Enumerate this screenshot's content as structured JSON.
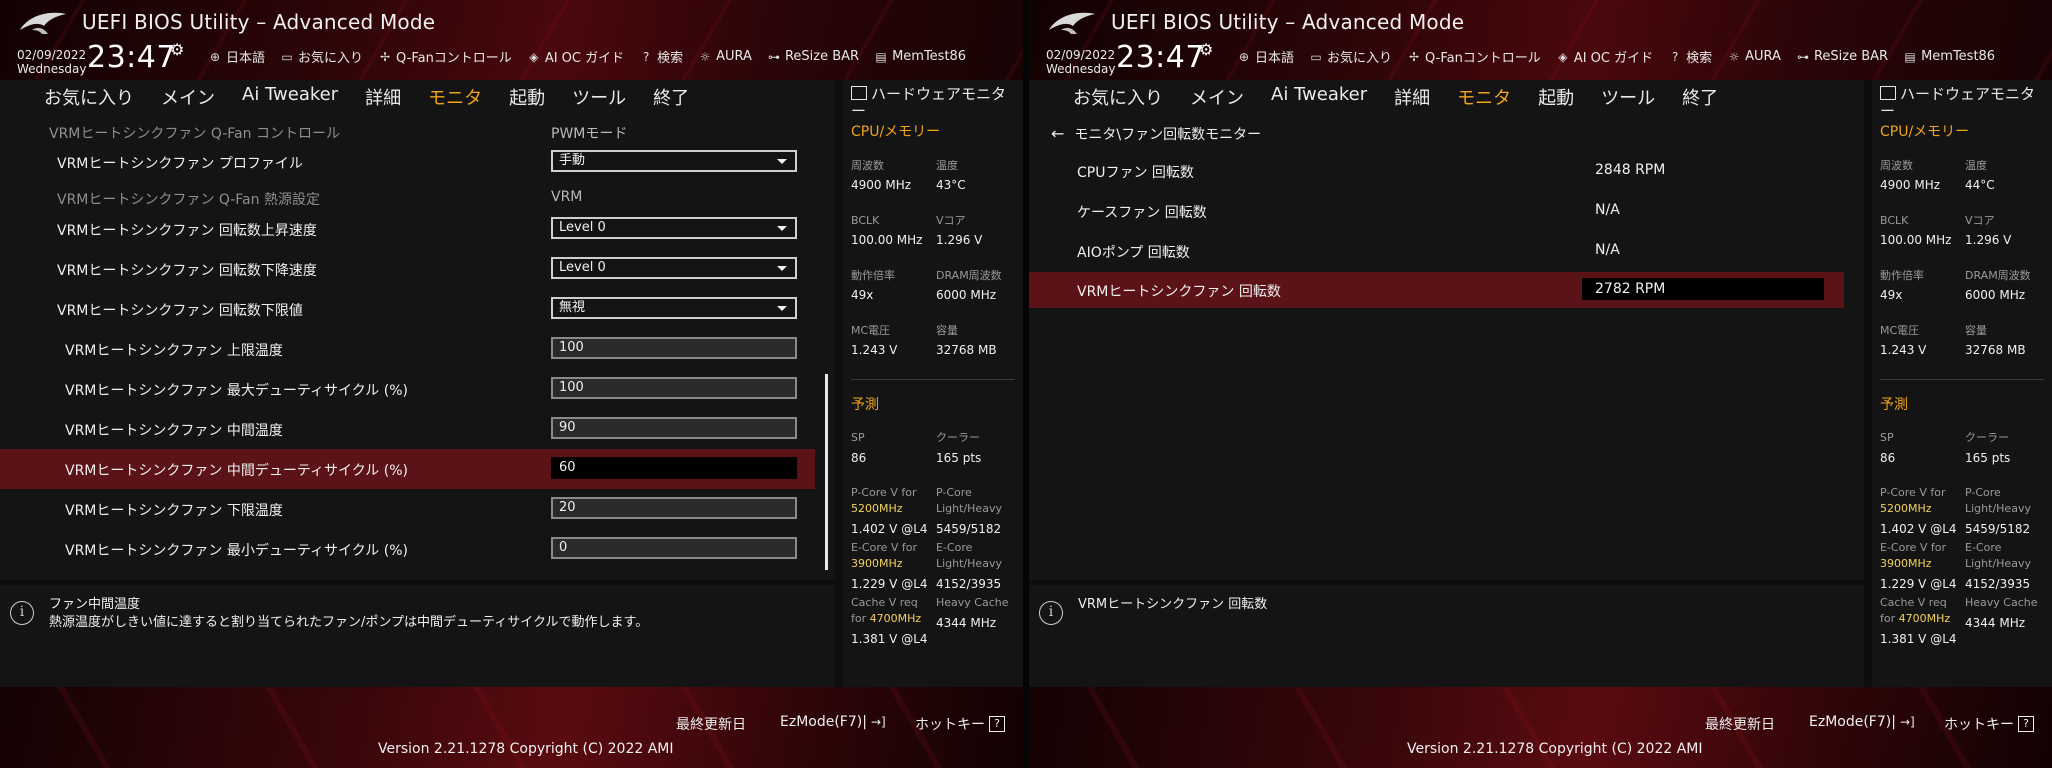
{
  "header": {
    "title": "UEFI BIOS Utility – Advanced Mode",
    "date": "02/09/2022",
    "weekday": "Wednesday",
    "time": "23:47",
    "toolbar": [
      {
        "icon": "globe-icon",
        "label": "日本語"
      },
      {
        "icon": "favorites-icon",
        "label": "お気に入り"
      },
      {
        "icon": "fan-icon",
        "label": "Q-Fanコントロール"
      },
      {
        "icon": "ai-oc-icon",
        "label": "AI OC ガイド"
      },
      {
        "icon": "help-icon",
        "label": "検索"
      },
      {
        "icon": "aura-icon",
        "label": "AURA"
      },
      {
        "icon": "resize-bar-icon",
        "label": "ReSize BAR"
      },
      {
        "icon": "memtest-icon",
        "label": "MemTest86"
      }
    ]
  },
  "menu": [
    "お気に入り",
    "メイン",
    "Ai Tweaker",
    "詳細",
    "モニタ",
    "起動",
    "ツール",
    "終了"
  ],
  "menu_active": "モニタ",
  "left": {
    "rows": [
      {
        "label": "VRMヒートシンクファン Q-Fan コントロール",
        "value": "PWMモード"
      },
      {
        "label": "VRMヒートシンクファン プロファイル",
        "value": "手動"
      },
      {
        "label": "VRMヒートシンクファン Q-Fan 熱源設定",
        "value": "VRM"
      },
      {
        "label": "VRMヒートシンクファン 回転数上昇速度",
        "value": "Level 0"
      },
      {
        "label": "VRMヒートシンクファン 回転数下降速度",
        "value": "Level 0"
      },
      {
        "label": "VRMヒートシンクファン 回転数下限値",
        "value": "無視"
      },
      {
        "label": "VRMヒートシンクファン 上限温度",
        "value": "100"
      },
      {
        "label": "VRMヒートシンクファン 最大デューティサイクル (%)",
        "value": "100"
      },
      {
        "label": "VRMヒートシンクファン 中間温度",
        "value": "90"
      },
      {
        "label": "VRMヒートシンクファン 中間デューティサイクル (%)",
        "value": "60"
      },
      {
        "label": "VRMヒートシンクファン 下限温度",
        "value": "20"
      },
      {
        "label": "VRMヒートシンクファン 最小デューティサイクル (%)",
        "value": "0"
      }
    ],
    "help_title": "ファン中間温度",
    "help_text": "熱源温度がしきい値に達すると割り当てられたファン/ポンプは中間デューティサイクルで動作します。"
  },
  "right": {
    "breadcrumb": "モニタ\\ファン回転数モニター",
    "rows": [
      {
        "label": "CPUファン 回転数",
        "value": "2848 RPM"
      },
      {
        "label": "ケースファン 回転数",
        "value": "N/A"
      },
      {
        "label": "AIOポンプ 回転数",
        "value": "N/A"
      },
      {
        "label": "VRMヒートシンクファン 回転数",
        "value": "2782 RPM"
      }
    ],
    "help_title": "VRMヒートシンクファン 回転数"
  },
  "hw_left": {
    "title": "ハードウェアモニター",
    "section_cpu": "CPU/メモリー",
    "freq_label": "周波数",
    "freq_value": "4900 MHz",
    "temp_label": "温度",
    "temp_value": "43°C",
    "bclk_label": "BCLK",
    "bclk_value": "100.00 MHz",
    "vcore_label": "Vコア",
    "vcore_value": "1.296 V",
    "ratio_label": "動作倍率",
    "ratio_value": "49x",
    "dram_label": "DRAM周波数",
    "dram_value": "6000 MHz",
    "mc_label": "MC電圧",
    "mc_value": "1.243 V",
    "cap_label": "容量",
    "cap_value": "32768 MB",
    "section_pred": "予測",
    "sp_label": "SP",
    "sp_value": "86",
    "cooler_label": "クーラー",
    "cooler_value": "165 pts",
    "pcore_v_label": "P-Core V for",
    "pcore_v_freq": "5200MHz",
    "pcore_v_value": "1.402 V @L4",
    "pcore_lh_label1": "P-Core",
    "pcore_lh_label2": "Light/Heavy",
    "pcore_lh_value": "5459/5182",
    "ecore_v_label": "E-Core V for",
    "ecore_v_freq": "3900MHz",
    "ecore_v_value": "1.229 V @L4",
    "ecore_lh_label1": "E-Core",
    "ecore_lh_label2": "Light/Heavy",
    "ecore_lh_value": "4152/3935",
    "cache_v_label1": "Cache V req",
    "cache_v_label2": "for",
    "cache_v_freq": "4700MHz",
    "cache_v_value": "1.381 V @L4",
    "heavy_cache_label": "Heavy Cache",
    "heavy_cache_value": "4344 MHz"
  },
  "hw_right": {
    "title": "ハードウェアモニター",
    "section_cpu": "CPU/メモリー",
    "freq_label": "周波数",
    "freq_value": "4900 MHz",
    "temp_label": "温度",
    "temp_value": "44°C",
    "bclk_label": "BCLK",
    "bclk_value": "100.00 MHz",
    "vcore_label": "Vコア",
    "vcore_value": "1.296 V",
    "ratio_label": "動作倍率",
    "ratio_value": "49x",
    "dram_label": "DRAM周波数",
    "dram_value": "6000 MHz",
    "mc_label": "MC電圧",
    "mc_value": "1.243 V",
    "cap_label": "容量",
    "cap_value": "32768 MB",
    "section_pred": "予測",
    "sp_label": "SP",
    "sp_value": "86",
    "cooler_label": "クーラー",
    "cooler_value": "165 pts",
    "pcore_v_label": "P-Core V for",
    "pcore_v_freq": "5200MHz",
    "pcore_v_value": "1.402 V @L4",
    "pcore_lh_label1": "P-Core",
    "pcore_lh_label2": "Light/Heavy",
    "pcore_lh_value": "5459/5182",
    "ecore_v_label": "E-Core V for",
    "ecore_v_freq": "3900MHz",
    "ecore_v_value": "1.229 V @L4",
    "ecore_lh_label1": "E-Core",
    "ecore_lh_label2": "Light/Heavy",
    "ecore_lh_value": "4152/3935",
    "cache_v_label1": "Cache V req",
    "cache_v_label2": "for",
    "cache_v_freq": "4700MHz",
    "cache_v_value": "1.381 V @L4",
    "heavy_cache_label": "Heavy Cache",
    "heavy_cache_value": "4344 MHz"
  },
  "footer": {
    "last_modified": "最終更新日",
    "ezmode": "EzMode(F7)|",
    "hotkey": "ホットキー",
    "hotkey_key": "?",
    "copyright": "Version 2.21.1278 Copyright (C) 2022 AMI"
  },
  "colors": {
    "accent": "#f0a419",
    "selected_row": "#5c1318",
    "highlight": "#f2d25a"
  }
}
